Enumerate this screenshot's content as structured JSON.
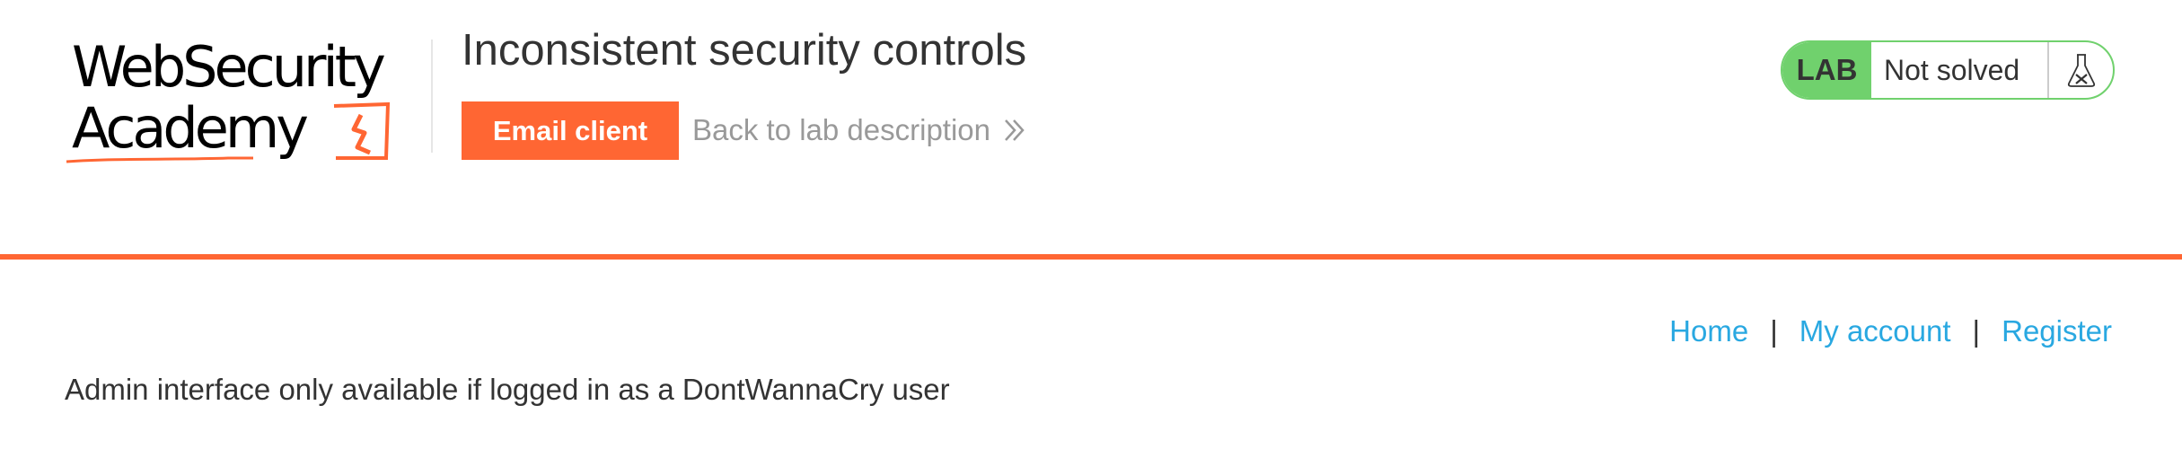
{
  "logo": {
    "line1": "WebSecurity",
    "line2": "Academy",
    "icon": "academy-logo-icon"
  },
  "lab": {
    "title": "Inconsistent security controls",
    "email_button": "Email client",
    "back_link": "Back to lab description",
    "back_icon": "double-chevron-right-icon"
  },
  "status": {
    "tag": "LAB",
    "text": "Not solved",
    "icon": "flask-icon",
    "color": "#70d16d"
  },
  "nav": {
    "home": "Home",
    "my_account": "My account",
    "register": "Register",
    "separator": "|"
  },
  "main": {
    "message": "Admin interface only available if logged in as a DontWannaCry user"
  },
  "colors": {
    "accent": "#ff6633",
    "link": "#29a8e1",
    "status_green": "#70d16d"
  }
}
